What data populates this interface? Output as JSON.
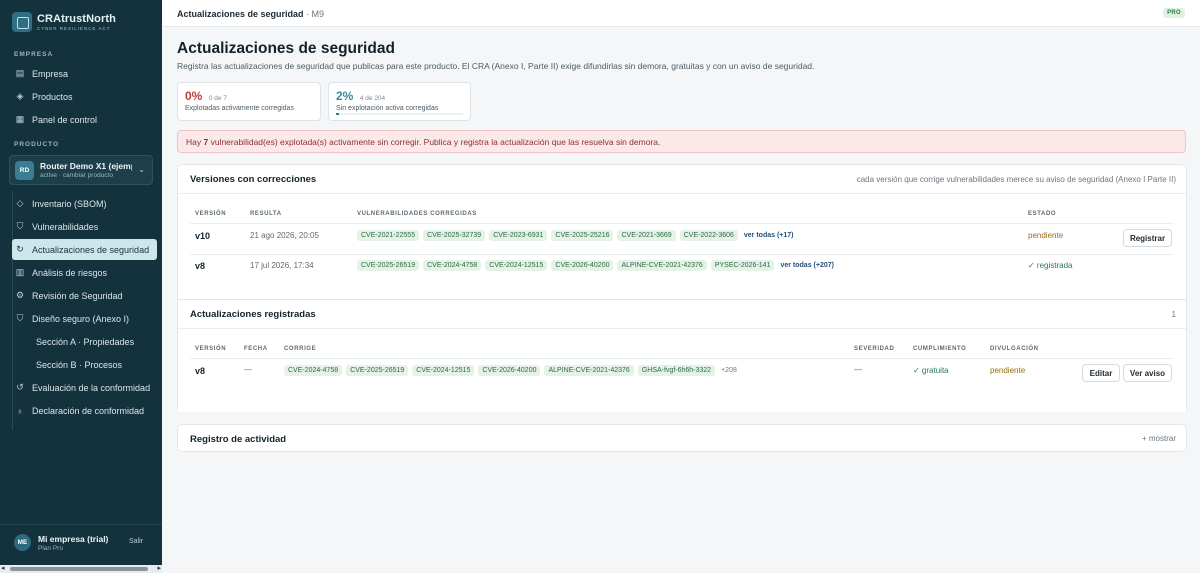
{
  "brand": {
    "name": "CRAtrustNorth",
    "subtitle": "CYBER RESILIENCE ACT"
  },
  "sidebar": {
    "section_company": "EMPRESA",
    "company_items": [
      {
        "label": "Empresa",
        "icon": "building-icon"
      },
      {
        "label": "Productos",
        "icon": "box-icon"
      },
      {
        "label": "Panel de control",
        "icon": "grid-icon"
      }
    ],
    "section_product": "PRODUCTO",
    "product": {
      "avatar": "RD",
      "name": "Router Demo X1 (ejemplo)",
      "sub": "active · cambiar producto"
    },
    "product_items": [
      {
        "label": "Inventario (SBOM)",
        "icon": "layers-icon"
      },
      {
        "label": "Vulnerabilidades",
        "icon": "shield-icon"
      },
      {
        "label": "Actualizaciones de seguridad",
        "icon": "refresh-icon",
        "active": true
      },
      {
        "label": "Análisis de riesgos",
        "icon": "chart-icon"
      },
      {
        "label": "Revisión de Seguridad",
        "icon": "gear-icon"
      },
      {
        "label": "Diseño seguro (Anexo I)",
        "icon": "shield-check-icon"
      },
      {
        "label": "Sección A · Propiedades",
        "sub": true
      },
      {
        "label": "Sección B · Procesos",
        "sub": true
      },
      {
        "label": "Evaluación de la conformidad",
        "icon": "clipboard-icon"
      },
      {
        "label": "Declaración de conformidad",
        "icon": "award-icon"
      }
    ],
    "user": {
      "avatar": "ME",
      "name": "Mi empresa (trial)",
      "plan": "Plan Pro",
      "logout": "Salir"
    }
  },
  "topbar": {
    "title": "Actualizaciones de seguridad",
    "module": "· M9",
    "badge": "PRO"
  },
  "page": {
    "title": "Actualizaciones de seguridad",
    "description": "Registra las actualizaciones de seguridad que publicas para este producto. El CRA (Anexo I, Parte II) exige difundirlas sin demora, gratuitas y con un aviso de seguridad."
  },
  "stats": [
    {
      "value": "0%",
      "detail": "0 de 7",
      "caption": "Explotadas activamente corregidas",
      "fraction": 0.0
    },
    {
      "value": "2%",
      "detail": "4 de 204",
      "caption": "Sin explotación activa corregidas",
      "fraction": 0.02
    }
  ],
  "alert": {
    "prefix": "Hay ",
    "count": "7",
    "suffix": " vulnerabilidad(es) explotada(s) activamente sin corregir. Publica y registra la actualización que las resuelva sin demora."
  },
  "versions": {
    "title": "Versiones con correcciones",
    "note": "cada versión que corrige vulnerabilidades merece su aviso de seguridad (Anexo I Parte II)",
    "headers": {
      "version": "VERSIÓN",
      "found": "RESULTA",
      "vulns": "VULNERABILIDADES CORREGIDAS",
      "status": "ESTADO"
    },
    "rows": [
      {
        "version": "v10",
        "date": "21 ago 2026, 20:05",
        "chips": [
          "CVE-2021-22555",
          "CVE-2025-32739",
          "CVE-2023-6931",
          "CVE-2025-25216",
          "CVE-2021-3669",
          "CVE-2022-3606"
        ],
        "more": "ver todas (+17)",
        "status": "pendiente",
        "action": "Registrar"
      },
      {
        "version": "v8",
        "date": "17 jul 2026, 17:34",
        "chips": [
          "CVE-2025-26519",
          "CVE-2024-4758",
          "CVE-2024-12515",
          "CVE-2026-40200",
          "ALPINE-CVE-2021-42376",
          "PYSEC-2026-141"
        ],
        "more": "ver todas (+207)",
        "status": "✓ registrada"
      }
    ]
  },
  "registered": {
    "title": "Actualizaciones registradas",
    "count": "1",
    "headers": {
      "version": "VERSIÓN",
      "date": "FECHA",
      "fixes": "CORRIGE",
      "severity": "SEVERIDAD",
      "compliance": "CUMPLIMIENTO",
      "disclosure": "DIVULGACIÓN"
    },
    "rows": [
      {
        "version": "v8",
        "date": "—",
        "chips": [
          "CVE-2024-4758",
          "CVE-2025-26519",
          "CVE-2024-12515",
          "CVE-2026-40200",
          "ALPINE-CVE-2021-42376",
          "GHSA-fvgf-6h6h-3322"
        ],
        "more": "+208",
        "severity": "—",
        "compliance": "✓ gratuita",
        "disclosure": "pendiente",
        "edit": "Editar",
        "view": "Ver aviso"
      }
    ]
  },
  "activity": {
    "title": "Registro de actividad",
    "toggle": "+ mostrar"
  }
}
